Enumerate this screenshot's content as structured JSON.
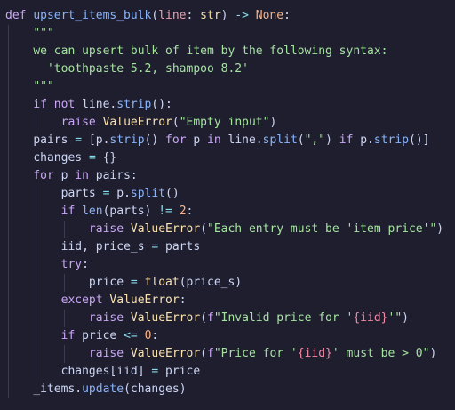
{
  "editor": {
    "language": "python",
    "theme": {
      "background": "#1e1e2e",
      "guide": "#3a3d52",
      "kw": "#cba6f7",
      "fn": "#89b4fa",
      "pl": "#cdd6f4",
      "st": "#a6e3a1",
      "nm": "#fab387",
      "op": "#89dceb",
      "ex": "#f9e2af",
      "pm": "#eba0ac",
      "bv": "#f38ba8"
    },
    "lines": [
      {
        "indent": 0,
        "tokens": [
          [
            "kw",
            "def "
          ],
          [
            "fn",
            "upsert_items_bulk"
          ],
          [
            "pl",
            "("
          ],
          [
            "pm",
            "line"
          ],
          [
            "pl",
            ": "
          ],
          [
            "ex",
            "str"
          ],
          [
            "pl",
            ") "
          ],
          [
            "op",
            "->"
          ],
          [
            "pl",
            " "
          ],
          [
            "bi",
            "None"
          ],
          [
            "pl",
            ":"
          ]
        ]
      },
      {
        "indent": 1,
        "tokens": [
          [
            "st",
            "\"\"\""
          ]
        ]
      },
      {
        "indent": 1,
        "tokens": [
          [
            "st",
            "we can upsert bulk of item by the following syntax:"
          ]
        ]
      },
      {
        "indent": 1,
        "tokens": [
          [
            "st",
            "  'toothpaste 5.2, shampoo 8.2'"
          ]
        ]
      },
      {
        "indent": 1,
        "tokens": [
          [
            "st",
            "\"\"\""
          ]
        ]
      },
      {
        "indent": 1,
        "tokens": [
          [
            "kw",
            "if not "
          ],
          [
            "pl",
            "line."
          ],
          [
            "fn",
            "strip"
          ],
          [
            "pl",
            "():"
          ]
        ]
      },
      {
        "indent": 2,
        "tokens": [
          [
            "kw",
            "raise "
          ],
          [
            "ex",
            "ValueError"
          ],
          [
            "pl",
            "("
          ],
          [
            "st",
            "\"Empty input\""
          ],
          [
            "pl",
            ")"
          ]
        ]
      },
      {
        "indent": 1,
        "tokens": [
          [
            "pl",
            "pairs "
          ],
          [
            "op",
            "="
          ],
          [
            "pl",
            " [p."
          ],
          [
            "fn",
            "strip"
          ],
          [
            "pl",
            "() "
          ],
          [
            "kw",
            "for "
          ],
          [
            "pl",
            "p "
          ],
          [
            "kw",
            "in "
          ],
          [
            "pl",
            "line."
          ],
          [
            "fn",
            "split"
          ],
          [
            "pl",
            "("
          ],
          [
            "st",
            "\",\""
          ],
          [
            "pl",
            ") "
          ],
          [
            "kw",
            "if "
          ],
          [
            "pl",
            "p."
          ],
          [
            "fn",
            "strip"
          ],
          [
            "pl",
            "()]"
          ]
        ]
      },
      {
        "indent": 1,
        "tokens": [
          [
            "pl",
            "changes "
          ],
          [
            "op",
            "="
          ],
          [
            "pl",
            " {}"
          ]
        ]
      },
      {
        "indent": 1,
        "tokens": [
          [
            "kw",
            "for "
          ],
          [
            "pl",
            "p "
          ],
          [
            "kw",
            "in "
          ],
          [
            "pl",
            "pairs:"
          ]
        ]
      },
      {
        "indent": 2,
        "tokens": [
          [
            "pl",
            "parts "
          ],
          [
            "op",
            "="
          ],
          [
            "pl",
            " p."
          ],
          [
            "fn",
            "split"
          ],
          [
            "pl",
            "()"
          ]
        ]
      },
      {
        "indent": 2,
        "tokens": [
          [
            "kw",
            "if "
          ],
          [
            "fn",
            "len"
          ],
          [
            "pl",
            "(parts) "
          ],
          [
            "op",
            "!="
          ],
          [
            "pl",
            " "
          ],
          [
            "nm",
            "2"
          ],
          [
            "pl",
            ":"
          ]
        ]
      },
      {
        "indent": 3,
        "tokens": [
          [
            "kw",
            "raise "
          ],
          [
            "ex",
            "ValueError"
          ],
          [
            "pl",
            "("
          ],
          [
            "st",
            "\"Each entry must be 'item price'\""
          ],
          [
            "pl",
            ")"
          ]
        ]
      },
      {
        "indent": 2,
        "tokens": [
          [
            "pl",
            "iid, price_s "
          ],
          [
            "op",
            "="
          ],
          [
            "pl",
            " parts"
          ]
        ]
      },
      {
        "indent": 2,
        "tokens": [
          [
            "kw",
            "try"
          ],
          [
            "pl",
            ":"
          ]
        ]
      },
      {
        "indent": 3,
        "tokens": [
          [
            "pl",
            "price "
          ],
          [
            "op",
            "="
          ],
          [
            "pl",
            " "
          ],
          [
            "ex",
            "float"
          ],
          [
            "pl",
            "(price_s)"
          ]
        ]
      },
      {
        "indent": 2,
        "tokens": [
          [
            "kw",
            "except "
          ],
          [
            "ex",
            "ValueError"
          ],
          [
            "pl",
            ":"
          ]
        ]
      },
      {
        "indent": 3,
        "tokens": [
          [
            "kw",
            "raise "
          ],
          [
            "ex",
            "ValueError"
          ],
          [
            "pl",
            "("
          ],
          [
            "kw",
            "f"
          ],
          [
            "st",
            "\"Invalid price for '"
          ],
          [
            "bv",
            "{iid}"
          ],
          [
            "st",
            "'\""
          ],
          [
            "pl",
            ")"
          ]
        ]
      },
      {
        "indent": 2,
        "tokens": [
          [
            "kw",
            "if "
          ],
          [
            "pl",
            "price "
          ],
          [
            "op",
            "<="
          ],
          [
            "pl",
            " "
          ],
          [
            "nm",
            "0"
          ],
          [
            "pl",
            ":"
          ]
        ]
      },
      {
        "indent": 3,
        "tokens": [
          [
            "kw",
            "raise "
          ],
          [
            "ex",
            "ValueError"
          ],
          [
            "pl",
            "("
          ],
          [
            "kw",
            "f"
          ],
          [
            "st",
            "\"Price for '"
          ],
          [
            "bv",
            "{iid}"
          ],
          [
            "st",
            "' must be > 0\""
          ],
          [
            "pl",
            ")"
          ]
        ]
      },
      {
        "indent": 2,
        "tokens": [
          [
            "pl",
            "changes[iid] "
          ],
          [
            "op",
            "="
          ],
          [
            "pl",
            " price"
          ]
        ]
      },
      {
        "indent": 1,
        "tokens": [
          [
            "pl",
            "_items."
          ],
          [
            "fn",
            "update"
          ],
          [
            "pl",
            "(changes)"
          ]
        ]
      }
    ]
  }
}
